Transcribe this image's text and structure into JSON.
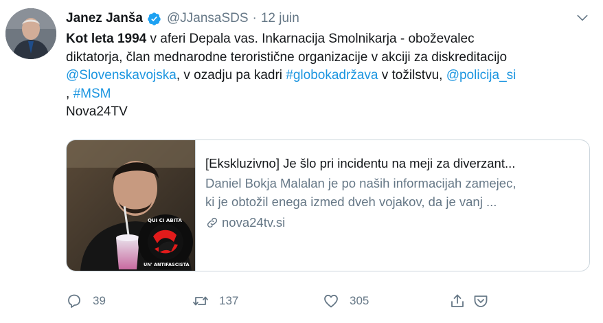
{
  "tweet": {
    "author": {
      "name": "Janez Janša",
      "handle": "@JJansaSDS",
      "separator": "·",
      "date": "12 juin",
      "verified": true
    },
    "body": {
      "line1_bold": "Kot leta 1994",
      "line1_rest": " v aferi Depala vas. Inkarnacija Smolnikarja - oboževalec",
      "line2": "diktatorja, član mednarodne teroristične organizacije v akciji za diskreditacijo",
      "line3_mention1": "@Slovenskavojska",
      "line3_text1": ", v ozadju pa kadri ",
      "line3_hashtag1": "#globokadržava",
      "line3_text2": " v tožilstvu, ",
      "line3_mention2": "@policija_si",
      "line4_text": ", ",
      "line4_hashtag": "#MSM",
      "line5": "Nova24TV"
    },
    "card": {
      "title": "[Ekskluzivno] Je šlo pri incidentu na meji za diverzant...",
      "description_line1": "Daniel Bokja Malalan je po naših informacijah zamejec,",
      "description_line2": "ki je obtožil enega izmed dveh vojakov, da je vanj ...",
      "domain": "nova24tv.si",
      "image_badge_top": "QUI CI ABITA",
      "image_badge_bottom": "UN' ANTIFASCISTA"
    },
    "actions": {
      "reply_count": "39",
      "retweet_count": "137",
      "like_count": "305"
    },
    "colors": {
      "link": "#1b95e0",
      "muted": "#657786",
      "border": "#ccd6dd",
      "verified": "#1da1f2"
    }
  }
}
